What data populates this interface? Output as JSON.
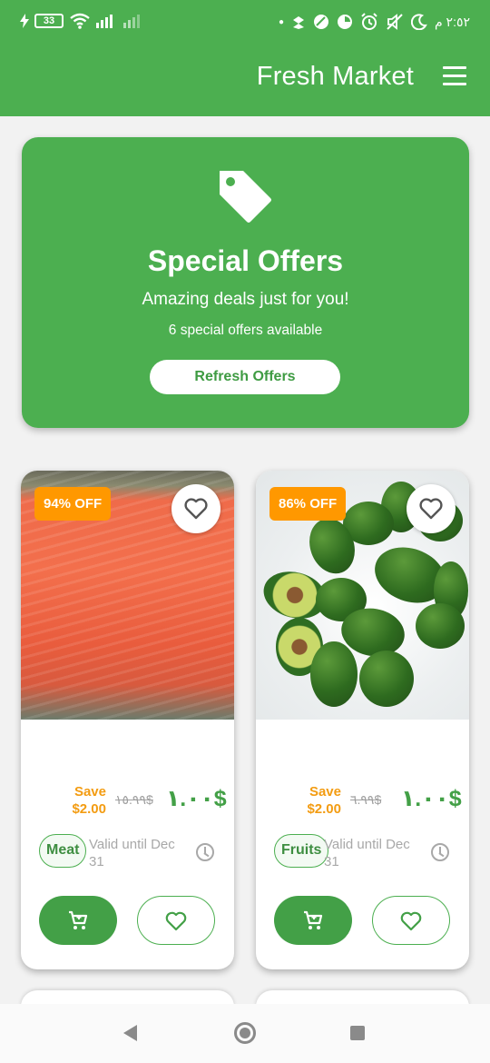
{
  "status_bar": {
    "battery": "33",
    "time": "٢:٥٢ م"
  },
  "app_bar": {
    "title": "Fresh Market",
    "menu_icon": "hamburger-menu-icon"
  },
  "hero": {
    "icon": "tag-icon",
    "title": "Special Offers",
    "subtitle": "Amazing deals just for you!",
    "count_text": "6 special offers available",
    "refresh_label": "Refresh Offers"
  },
  "products": [
    {
      "image": "salmon",
      "discount_badge": "94% OFF",
      "save_label": "Save",
      "save_amount": "$2.00",
      "old_price": "١٥.٩٩$",
      "price": "١.٠٠$",
      "category": "Meat",
      "valid_text": "Valid until Dec 31"
    },
    {
      "image": "avocado",
      "discount_badge": "86% OFF",
      "save_label": "Save",
      "save_amount": "$2.00",
      "old_price": "٦.٩٩$",
      "price": "١.٠٠$",
      "category": "Fruits",
      "valid_text": "Valid until Dec 31"
    }
  ],
  "colors": {
    "primary": "#4caf50",
    "accent": "#ff9800",
    "price": "#43a047"
  }
}
